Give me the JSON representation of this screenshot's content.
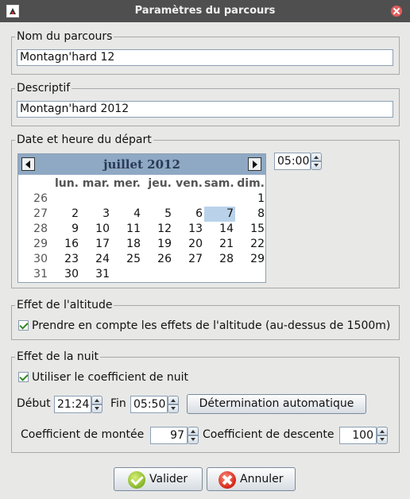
{
  "window": {
    "title": "Paramètres du parcours"
  },
  "name_group": {
    "label": "Nom du parcours",
    "value": "Montagn'hard 12"
  },
  "desc_group": {
    "label": "Descriptif",
    "value": "Montagn'hard 2012"
  },
  "date_group": {
    "label": "Date et heure du départ",
    "time": "05:00",
    "calendar": {
      "month": "juillet 2012",
      "day_names": [
        "lun.",
        "mar.",
        "mer.",
        "jeu.",
        "ven.",
        "sam.",
        "dim."
      ],
      "weeks": [
        {
          "num": "26",
          "days": [
            "",
            "",
            "",
            "",
            "",
            "",
            "1"
          ]
        },
        {
          "num": "27",
          "days": [
            "2",
            "3",
            "4",
            "5",
            "6",
            "7",
            "8"
          ]
        },
        {
          "num": "28",
          "days": [
            "9",
            "10",
            "11",
            "12",
            "13",
            "14",
            "15"
          ]
        },
        {
          "num": "29",
          "days": [
            "16",
            "17",
            "18",
            "19",
            "20",
            "21",
            "22"
          ]
        },
        {
          "num": "30",
          "days": [
            "23",
            "24",
            "25",
            "26",
            "27",
            "28",
            "29"
          ]
        },
        {
          "num": "31",
          "days": [
            "30",
            "31",
            "",
            "",
            "",
            "",
            ""
          ]
        }
      ],
      "selected_day": "7"
    }
  },
  "altitude_group": {
    "label": "Effet de l'altitude",
    "checkbox_label": "Prendre en compte les effets de l'altitude (au-dessus de 1500m)",
    "checked": true
  },
  "night_group": {
    "label": "Effet de la nuit",
    "checkbox_label": "Utiliser le coefficient de nuit",
    "checked": true,
    "start_label": "Début",
    "start_value": "21:24",
    "end_label": "Fin",
    "end_value": "05:50",
    "auto_button": "Détermination automatique",
    "climb_label": "Coefficient de montée",
    "climb_value": "97",
    "descent_label": "Coefficient de descente",
    "descent_value": "100"
  },
  "buttons": {
    "ok": "Valider",
    "cancel": "Annuler"
  },
  "colors": {
    "titlebar": "#4f4f4f",
    "calendar_header": "#8fa9c4",
    "selected_day": "#b9d2ea"
  }
}
